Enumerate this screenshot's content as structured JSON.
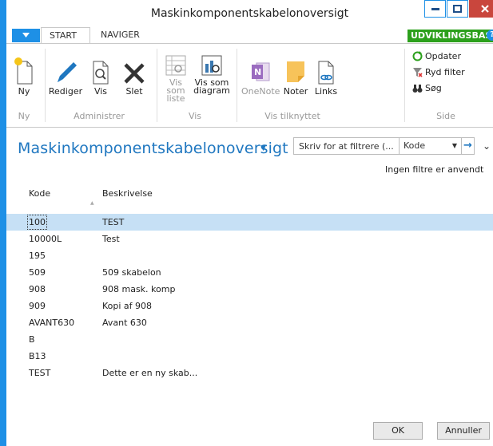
{
  "window": {
    "title": "Maskinkomponentskabelonoversigt"
  },
  "ribbon_tabs": {
    "start": "START",
    "naviger": "NAVIGER",
    "env_badge": "UDVIKLINGSBASE"
  },
  "ribbon": {
    "ny": "Ny",
    "rediger": "Rediger",
    "vis": "Vis",
    "slet": "Slet",
    "vis_som_liste_1": "Vis som",
    "vis_som_liste_2": "liste",
    "vis_som_diagram_1": "Vis som",
    "vis_som_diagram_2": "diagram",
    "onenote": "OneNote",
    "noter": "Noter",
    "links": "Links",
    "opdater": "Opdater",
    "ryd_filter": "Ryd filter",
    "soeg": "Søg",
    "groups": {
      "ny": "Ny",
      "administrer": "Administrer",
      "vis": "Vis",
      "vis_tilknyttet": "Vis tilknyttet",
      "side": "Side"
    }
  },
  "page": {
    "title": "Maskinkomponentskabelonoversigt",
    "filter_placeholder": "Skriv for at filtrere (...",
    "filter_field": "Kode",
    "no_filters": "Ingen filtre er anvendt"
  },
  "table": {
    "headers": {
      "kode": "Kode",
      "beskrivelse": "Beskrivelse"
    },
    "rows": [
      {
        "kode": "100",
        "beskrivelse": "TEST"
      },
      {
        "kode": "10000L",
        "beskrivelse": "Test"
      },
      {
        "kode": "195",
        "beskrivelse": ""
      },
      {
        "kode": "509",
        "beskrivelse": "509 skabelon"
      },
      {
        "kode": "908",
        "beskrivelse": "908 mask. komp"
      },
      {
        "kode": "909",
        "beskrivelse": "Kopi af 908"
      },
      {
        "kode": "AVANT630",
        "beskrivelse": "Avant 630"
      },
      {
        "kode": "B",
        "beskrivelse": ""
      },
      {
        "kode": "B13",
        "beskrivelse": ""
      },
      {
        "kode": "TEST",
        "beskrivelse": "Dette er en ny skab..."
      }
    ]
  },
  "buttons": {
    "ok": "OK",
    "cancel": "Annuller"
  }
}
